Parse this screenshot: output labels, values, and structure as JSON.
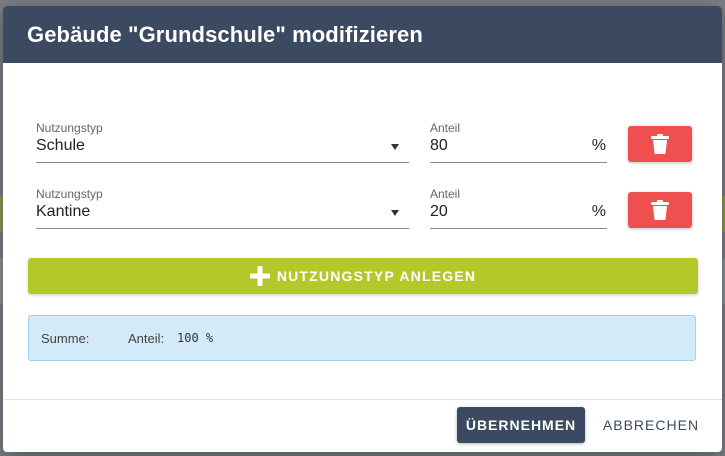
{
  "dialog": {
    "title": "Gebäude \"Grundschule\" modifizieren"
  },
  "rows": [
    {
      "usage_label": "Nutzungstyp",
      "usage_value": "Schule",
      "share_label": "Anteil",
      "share_value": "80",
      "unit": "%"
    },
    {
      "usage_label": "Nutzungstyp",
      "usage_value": "Kantine",
      "share_label": "Anteil",
      "share_value": "20",
      "unit": "%"
    }
  ],
  "add_button": {
    "label": "NUTZUNGSTYP ANLEGEN"
  },
  "summary": {
    "label": "Summe:",
    "share_key": "Anteil:",
    "share_value": "100 %"
  },
  "footer": {
    "apply_label": "ÜBERNEHMEN",
    "cancel_label": "ABBRECHEN"
  },
  "colors": {
    "header": "#3b4a60",
    "delete": "#ef4f4f",
    "add": "#b5c82a",
    "summary_bg": "#d3ebf8"
  },
  "icons": {
    "delete": "trash-icon",
    "add": "plus-icon",
    "dropdown": "caret-down-icon"
  }
}
